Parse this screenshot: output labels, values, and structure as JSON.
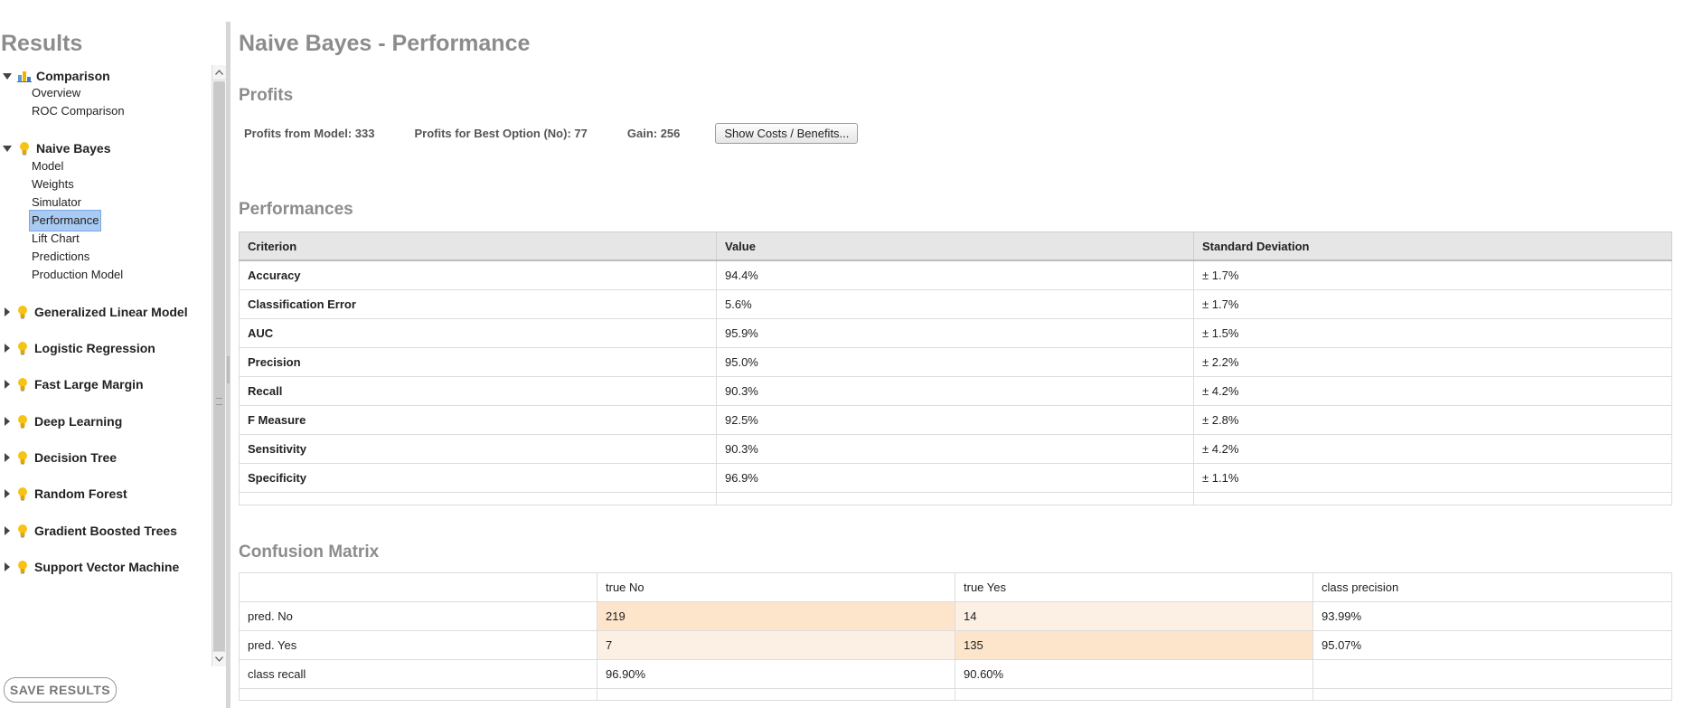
{
  "sidebar": {
    "title": "Results",
    "groups": [
      {
        "label": "Comparison",
        "icon": "comparison-chart-icon",
        "expanded": true,
        "children": [
          "Overview",
          "ROC Comparison"
        ]
      },
      {
        "label": "Naive Bayes",
        "icon": "lightbulb-icon",
        "expanded": true,
        "children": [
          "Model",
          "Weights",
          "Simulator",
          "Performance",
          "Lift Chart",
          "Predictions",
          "Production Model"
        ],
        "selected": "Performance"
      },
      {
        "label": "Generalized Linear Model",
        "icon": "lightbulb-icon",
        "expanded": false
      },
      {
        "label": "Logistic Regression",
        "icon": "lightbulb-icon",
        "expanded": false
      },
      {
        "label": "Fast Large Margin",
        "icon": "lightbulb-icon",
        "expanded": false
      },
      {
        "label": "Deep Learning",
        "icon": "lightbulb-icon",
        "expanded": false
      },
      {
        "label": "Decision Tree",
        "icon": "lightbulb-icon",
        "expanded": false
      },
      {
        "label": "Random Forest",
        "icon": "lightbulb-icon",
        "expanded": false
      },
      {
        "label": "Gradient Boosted Trees",
        "icon": "lightbulb-icon",
        "expanded": false
      },
      {
        "label": "Support Vector Machine",
        "icon": "lightbulb-icon",
        "expanded": false
      }
    ],
    "save_label": "SAVE RESULTS"
  },
  "main": {
    "title": "Naive Bayes - Performance",
    "profits": {
      "section_title": "Profits",
      "model": "Profits from Model: 333",
      "best_option": "Profits for Best Option (No): 77",
      "gain": "Gain: 256",
      "button_label": "Show Costs / Benefits..."
    },
    "performances": {
      "section_title": "Performances",
      "headers": [
        "Criterion",
        "Value",
        "Standard Deviation"
      ],
      "rows": [
        [
          "Accuracy",
          "94.4%",
          "± 1.7%"
        ],
        [
          "Classification Error",
          "5.6%",
          "± 1.7%"
        ],
        [
          "AUC",
          "95.9%",
          "± 1.5%"
        ],
        [
          "Precision",
          "95.0%",
          "± 2.2%"
        ],
        [
          "Recall",
          "90.3%",
          "± 4.2%"
        ],
        [
          "F Measure",
          "92.5%",
          "± 2.8%"
        ],
        [
          "Sensitivity",
          "90.3%",
          "± 4.2%"
        ],
        [
          "Specificity",
          "96.9%",
          "± 1.1%"
        ]
      ]
    },
    "confusion": {
      "section_title": "Confusion Matrix",
      "headers": [
        "",
        "true No",
        "true Yes",
        "class precision"
      ],
      "rows": [
        [
          "pred. No",
          "219",
          "14",
          "93.99%"
        ],
        [
          "pred. Yes",
          "7",
          "135",
          "95.07%"
        ],
        [
          "class recall",
          "96.90%",
          "90.60%",
          ""
        ]
      ]
    }
  },
  "colors": {
    "heading_gray": "#8c8c8c",
    "selected_bg": "#a9cbf3",
    "cell_strong": "#fde5cc",
    "cell_weak": "#fcf0e4",
    "bulb_yellow": "#f6c417"
  }
}
